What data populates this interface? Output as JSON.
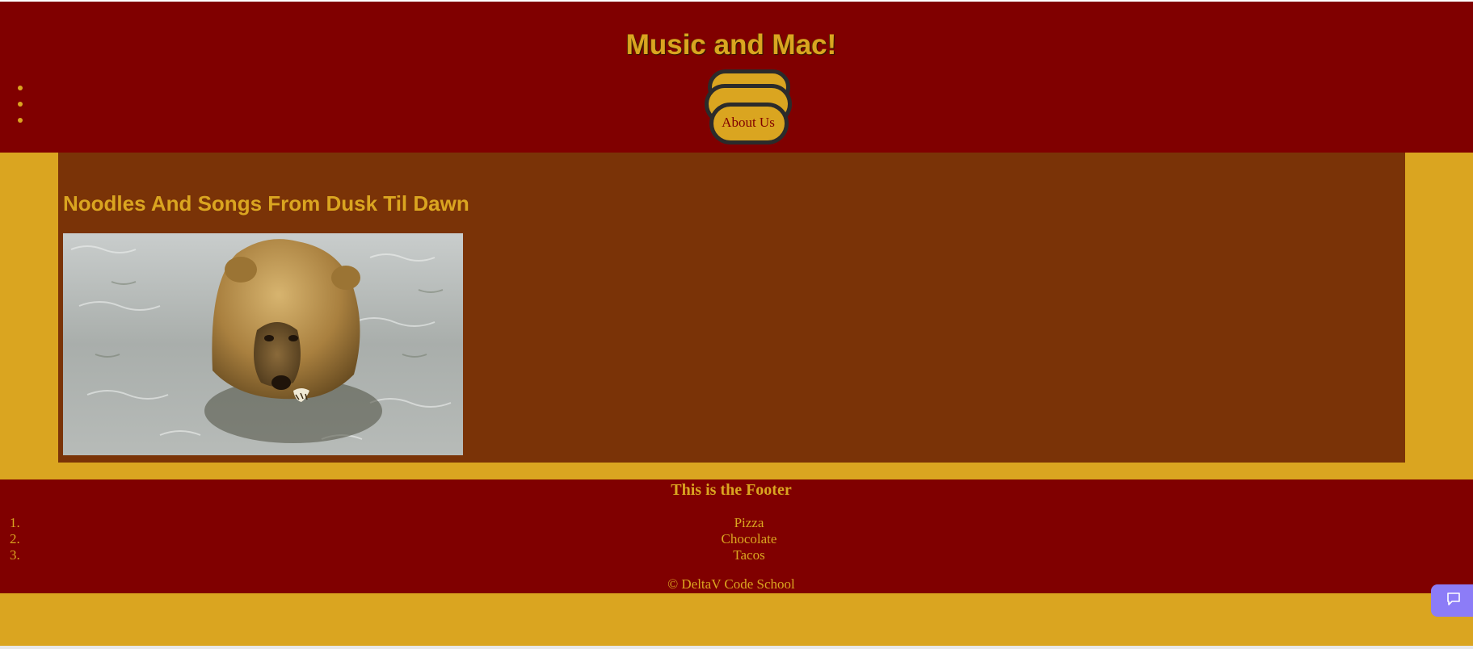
{
  "header": {
    "title": "Music and Mac!",
    "nav_bullet_count": 3,
    "about_label": "About Us"
  },
  "main": {
    "heading": "Noodles And Songs From Dusk Til Dawn",
    "image": "bear-in-water-photo"
  },
  "footer": {
    "heading": "This is the Footer",
    "items": [
      {
        "number": "1.",
        "label": "Pizza"
      },
      {
        "number": "2.",
        "label": "Chocolate"
      },
      {
        "number": "3.",
        "label": "Tacos"
      }
    ],
    "copyright": "© DeltaV Code School"
  },
  "widgets": {
    "chat_icon": "chat-bubble-icon"
  },
  "colors": {
    "header_bg": "#800000",
    "page_bg": "#daa520",
    "main_bg": "#7a3307",
    "accent": "#daa520",
    "chat_button": "#8c7cf7"
  }
}
